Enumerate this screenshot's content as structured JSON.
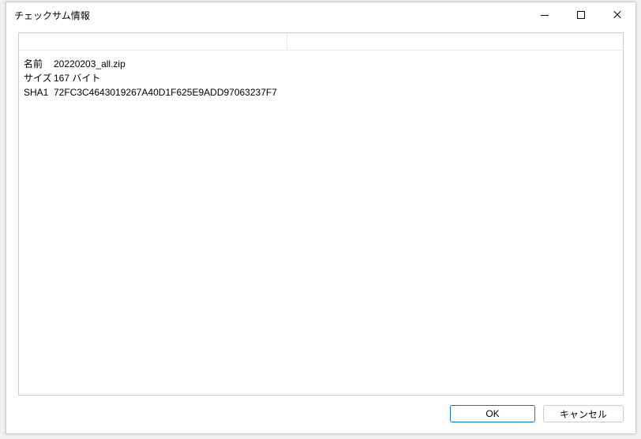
{
  "titlebar": {
    "title": "チェックサム情報"
  },
  "info": {
    "name_label": "名前",
    "name_value": "20220203_all.zip",
    "size_label": "サイズ",
    "size_value": "167 バイト",
    "sha1_label": "SHA1",
    "sha1_value": "72FC3C4643019267A40D1F625E9ADD97063237F7"
  },
  "buttons": {
    "ok": "OK",
    "cancel": "キャンセル"
  }
}
